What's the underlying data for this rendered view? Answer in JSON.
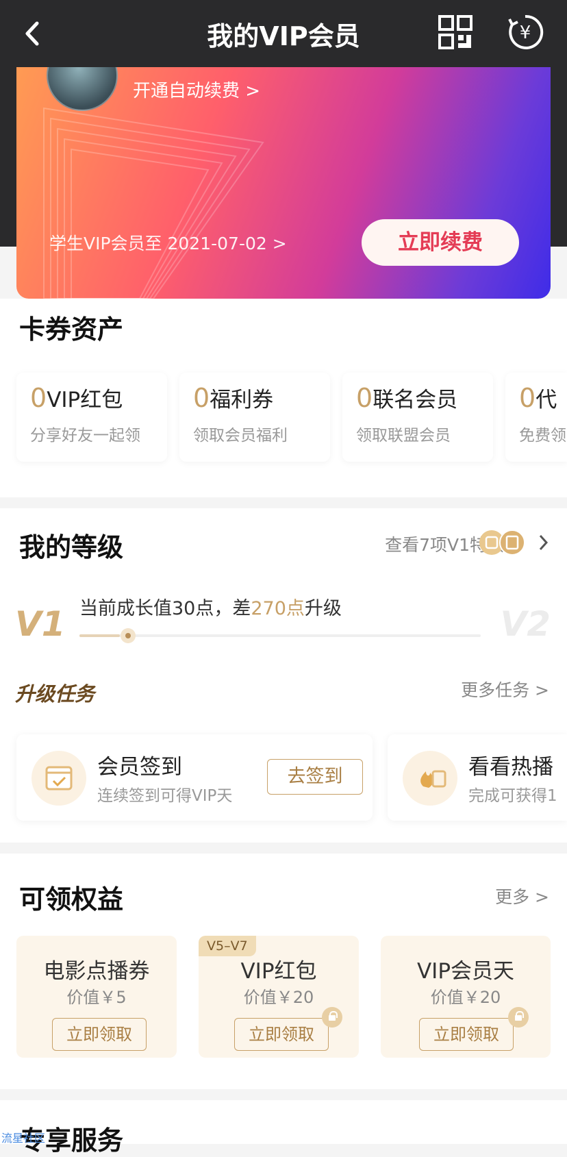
{
  "nav": {
    "back": "<",
    "title": "我的VIP会员",
    "qr_icon": "qrcode-icon",
    "coin_icon": "yuan-refresh-icon"
  },
  "card": {
    "auto_renew": "开通自动续费 >",
    "expire": "学生VIP会员至 2021-07-02 >",
    "renew_button": "立即续费"
  },
  "assets": {
    "title": "卡券资产",
    "items": [
      {
        "num": "0",
        "name": "VIP红包",
        "sub": "分享好友一起领"
      },
      {
        "num": "0",
        "name": "福利券",
        "sub": "领取会员福利"
      },
      {
        "num": "0",
        "name": "联名会员",
        "sub": "领取联盟会员"
      },
      {
        "num": "0",
        "name": "代",
        "sub": "免费领"
      }
    ]
  },
  "level": {
    "title": "我的等级",
    "view_privileges": "查看7项V1特权",
    "current": "V1",
    "next": "V2",
    "growth_prefix": "当前成长值30点，差",
    "growth_gap": "270点",
    "growth_suffix": "升级",
    "progress": 0.1
  },
  "tasks": {
    "title": "升级任务",
    "more": "更多任务 >",
    "items": [
      {
        "name": "会员签到",
        "sub": "连续签到可得VIP天",
        "button": "去签到"
      },
      {
        "name": "看看热播",
        "sub": "完成可获得1"
      }
    ]
  },
  "benefits": {
    "title": "可领权益",
    "more": "更多 >",
    "items": [
      {
        "name": "电影点播券",
        "value": "价值￥5",
        "button": "立即领取",
        "tag": "",
        "locked": false
      },
      {
        "name": "VIP红包",
        "value": "价值￥20",
        "button": "立即领取",
        "tag": "V5–V7",
        "locked": true
      },
      {
        "name": "VIP会员天",
        "value": "价值￥20",
        "button": "立即领取",
        "tag": "",
        "locked": true
      }
    ]
  },
  "services": {
    "title": "专享服务"
  },
  "watermark": "流星社区"
}
